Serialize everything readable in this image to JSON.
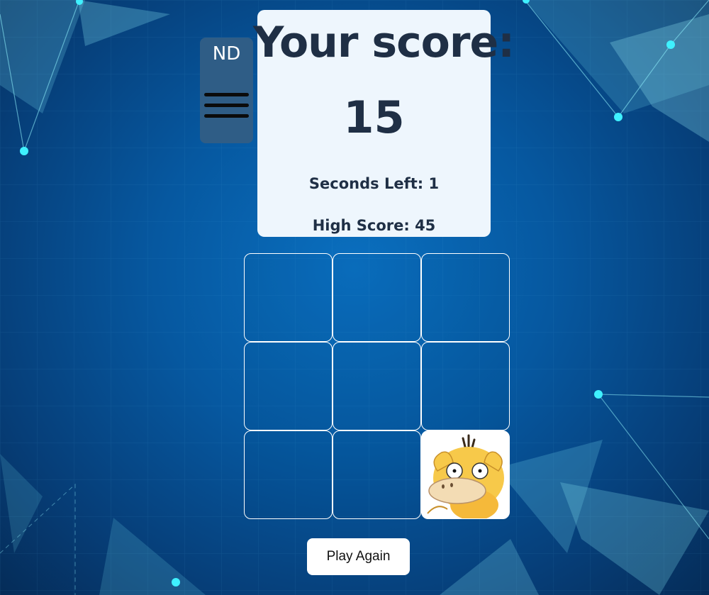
{
  "menu": {
    "initials": "ND",
    "icon": "hamburger-menu-icon"
  },
  "score_card": {
    "title": "Your score:",
    "score": "15",
    "seconds_left": "Seconds Left: 1",
    "high_score": "High Score: 45"
  },
  "board": {
    "rows": 3,
    "cols": 3,
    "cells": [
      {
        "label": "",
        "has_mole": false
      },
      {
        "label": "",
        "has_mole": false
      },
      {
        "label": "",
        "has_mole": false
      },
      {
        "label": "",
        "has_mole": false
      },
      {
        "label": "",
        "has_mole": false
      },
      {
        "label": "",
        "has_mole": false
      },
      {
        "label": "",
        "has_mole": false
      },
      {
        "label": "",
        "has_mole": false
      },
      {
        "label": "psyduck-character",
        "has_mole": true
      }
    ]
  },
  "play_again": {
    "label": "Play Again"
  },
  "colors": {
    "card_bg": "#eef6fd",
    "card_text": "#1f2f45",
    "menu_bg": "#2f5d86",
    "background": "#0658a0"
  }
}
